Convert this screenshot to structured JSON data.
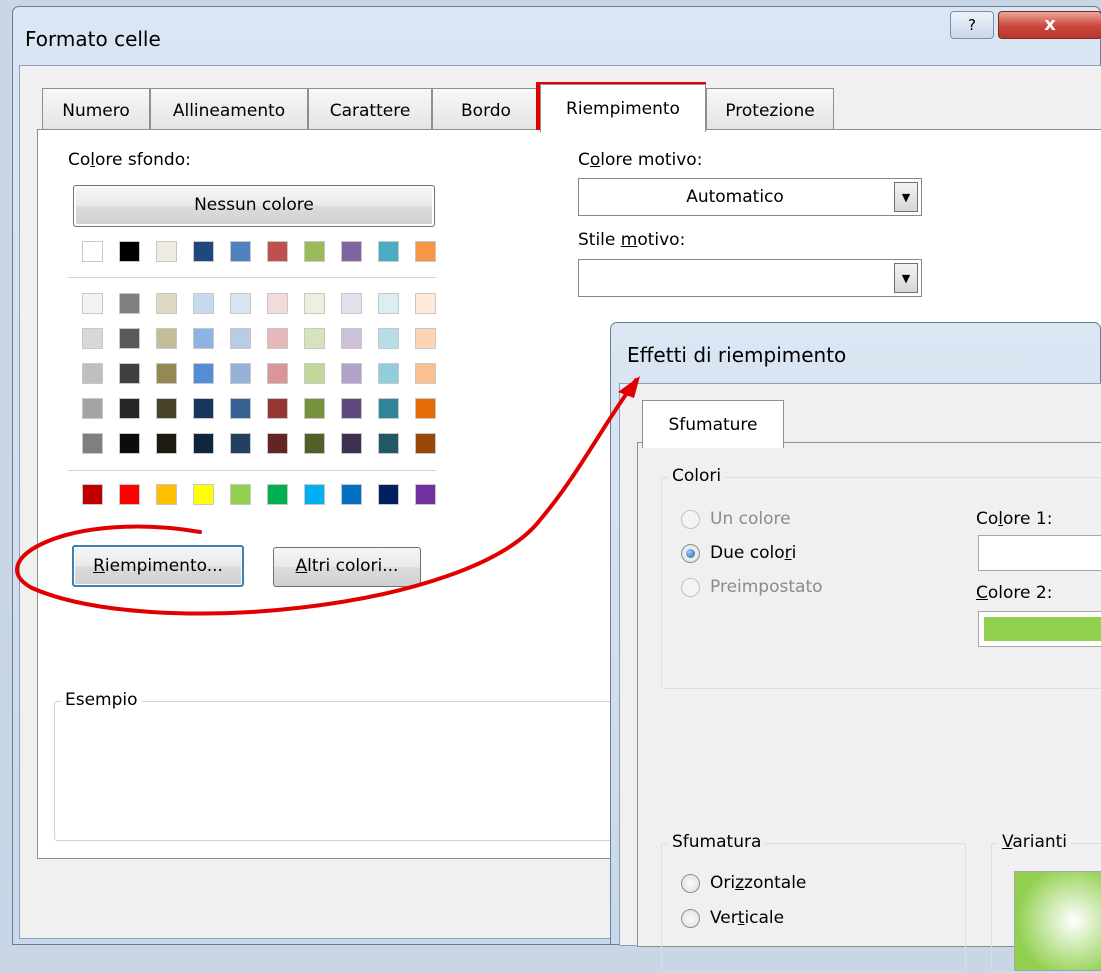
{
  "dialog1": {
    "title": "Formato celle",
    "tabs": [
      "Numero",
      "Allineamento",
      "Carattere",
      "Bordo",
      "Riempimento",
      "Protezione"
    ],
    "bg_color_label": "Colore sfondo:",
    "no_color_button": "Nessun colore",
    "pattern_color_label": "Colore motivo:",
    "pattern_color_value": "Automatico",
    "pattern_style_label": "Stile motivo:",
    "pattern_style_value": "",
    "fill_effects_button": "Riempimento...",
    "more_colors_button": "Altri colori...",
    "sample_label": "Esempio",
    "help_icon": "?",
    "close_icon": "x",
    "palette": {
      "row_top": [
        "#ffffff",
        "#000000",
        "#eeece1",
        "#1f497d",
        "#4f81bd",
        "#c0504d",
        "#9bbb59",
        "#8064a2",
        "#4bacc6",
        "#f79646"
      ],
      "tints": [
        [
          "#f2f2f2",
          "#7f7f7f",
          "#ddd9c3",
          "#c6d9f0",
          "#dbe5f1",
          "#f2dcdb",
          "#ebf1dd",
          "#e5e0ec",
          "#dbeef3",
          "#fdeada"
        ],
        [
          "#d8d8d8",
          "#595959",
          "#c4bd97",
          "#8db3e2",
          "#b8cce4",
          "#e5b9b7",
          "#d7e3bc",
          "#ccc1d9",
          "#b7dde8",
          "#fbd5b5"
        ],
        [
          "#bfbfbf",
          "#3f3f3f",
          "#938953",
          "#548dd4",
          "#95b3d7",
          "#d99694",
          "#c3d69b",
          "#b2a2c7",
          "#92cddc",
          "#fac08f"
        ],
        [
          "#a5a5a5",
          "#262626",
          "#494429",
          "#17365d",
          "#366092",
          "#953734",
          "#76923c",
          "#5f497a",
          "#31859b",
          "#e36c09"
        ],
        [
          "#7f7f7f",
          "#0c0c0c",
          "#1d1b10",
          "#0f243e",
          "#244061",
          "#632423",
          "#4f6128",
          "#3f3151",
          "#205867",
          "#974806"
        ]
      ],
      "standard": [
        "#c00000",
        "#ff0000",
        "#ffc000",
        "#ffff00",
        "#92d050",
        "#00b050",
        "#00b0f0",
        "#0070c0",
        "#002060",
        "#7030a0"
      ]
    }
  },
  "dialog2": {
    "title": "Effetti di riempimento",
    "tab": "Sfumature",
    "colors_group": "Colori",
    "opt_one": "Un colore",
    "opt_two": "Due colori",
    "opt_preset": "Preimpostato",
    "color1_label": "Colore 1:",
    "color2_label": "Colore 2:",
    "color1_value": "#ffffff",
    "color2_value": "#92d050",
    "shading_group": "Sfumatura",
    "variants_group": "Varianti",
    "opt_horizontal": "Orizzontale",
    "opt_vertical": "Verticale"
  },
  "annotation_color": "#e00000"
}
